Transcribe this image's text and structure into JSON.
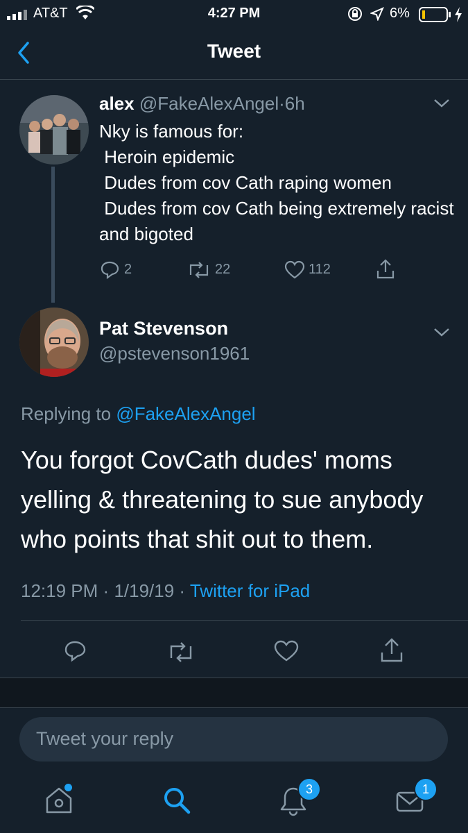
{
  "status_bar": {
    "carrier": "AT&T",
    "time": "4:27 PM",
    "battery_pct": "6%"
  },
  "header": {
    "title": "Tweet"
  },
  "parent_tweet": {
    "name": "alex",
    "handle": "@FakeAlexAngel",
    "age": "6h",
    "text": "Nky is famous for:\n Heroin epidemic\n Dudes from cov Cath raping women\n Dudes from cov Cath being extremely racist and bigoted",
    "replies": "2",
    "retweets": "22",
    "likes": "112"
  },
  "main_tweet": {
    "name": "Pat Stevenson",
    "handle": "@pstevenson1961",
    "replying_prefix": "Replying to",
    "replying_to": "@FakeAlexAngel",
    "text": "You forgot CovCath dudes' moms yelling & threatening to sue anybody who points that shit out to them.",
    "time": "12:19 PM",
    "date": "1/19/19",
    "source": "Twitter for iPad"
  },
  "reply_box": {
    "placeholder": "Tweet your reply"
  },
  "bottom_nav": {
    "notifications_badge": "3",
    "messages_badge": "1"
  },
  "colors": {
    "background": "#15202b",
    "accent": "#1da1f2",
    "muted": "#8899a6",
    "divider": "#38444d"
  }
}
